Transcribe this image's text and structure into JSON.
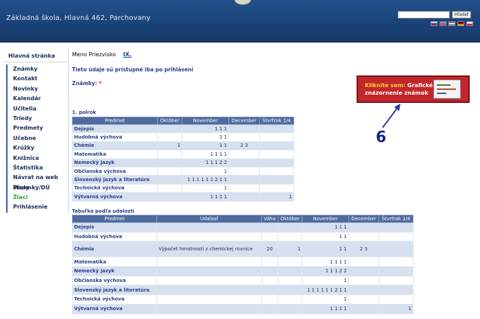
{
  "header": {
    "title": "Základná škola, Hlavná 462, Parchovany",
    "search_button": "Hľadať",
    "flags": [
      "sk",
      "en",
      "hu",
      "de",
      "pl"
    ]
  },
  "sidebar": {
    "title": "Hlavná stránka",
    "items": [
      "Známky",
      "Kontakt",
      "Novinky",
      "Kalendár",
      "Učitelia",
      "Triedy",
      "Predmety",
      "Učebne",
      "Krúžky",
      "Knižnica",
      "Štatistika",
      "Návrat na web školy",
      "Písomky/DÚ",
      "Žiaci",
      "Prihlásenie"
    ],
    "active": "Žiaci"
  },
  "main": {
    "user_name": "Meno Priezvisko",
    "user_class": "IX.",
    "notice": "Tieto údaje sú prístupné iba po prihlásení",
    "grades_label": "Známky:",
    "grades_star": "*"
  },
  "graph_button": {
    "highlight": "Kliknite sem:",
    "text_line1": "Grafické",
    "text_line2": "znázornenie známok"
  },
  "annotation_number": "6",
  "semester": {
    "label": "1. polrok",
    "headers": [
      "Predmet",
      "Október",
      "November",
      "December",
      "Štvrťrok 1/4"
    ],
    "rows": [
      [
        "Dejepis",
        "",
        "1 1 1",
        "",
        ""
      ],
      [
        "Hudobná výchova",
        "",
        "1 1",
        "",
        ""
      ],
      [
        "Chémia",
        "1",
        "1 1",
        "2 3",
        ""
      ],
      [
        "Matematika",
        "",
        "1 1 1 1",
        "",
        ""
      ],
      [
        "Nemecký jazyk",
        "",
        "1 1 1 2 2",
        "",
        ""
      ],
      [
        "Občianska výchova",
        "",
        "1",
        "",
        ""
      ],
      [
        "Slovenský jazyk a literatúra",
        "",
        "1 1 1 1 1 1 2 1 1",
        "",
        ""
      ],
      [
        "Technická výchova",
        "",
        "1",
        "",
        ""
      ],
      [
        "Výtvarná výchova",
        "",
        "1 1 1 1",
        "",
        "1"
      ]
    ]
  },
  "events": {
    "label": "Tabuľka podľa udalostí",
    "headers": [
      "Predmet",
      "Udalosť",
      "Váha",
      "Október",
      "November",
      "December",
      "Štvrťrok 1/4"
    ],
    "rows": [
      [
        "Dejepis",
        "",
        "",
        "",
        "1 1 1",
        "",
        ""
      ],
      [
        "Hudobná výchova",
        "",
        "",
        "",
        "1 1",
        "",
        ""
      ],
      [
        "Chémia",
        "Výpočet hmotnosti z chemickej rovnice",
        "20",
        "1",
        "1 1",
        "2 3",
        ""
      ],
      [
        "Matematika",
        "",
        "",
        "",
        "1 1 1 1",
        "",
        ""
      ],
      [
        "Nemecký jazyk",
        "",
        "",
        "",
        "1 1 1 2 2",
        "",
        ""
      ],
      [
        "Občianska výchova",
        "",
        "",
        "",
        "1",
        "",
        ""
      ],
      [
        "Slovenský jazyk a literatúra",
        "",
        "",
        "",
        "1 1 1 1 1 1 2 1 1",
        "",
        ""
      ],
      [
        "Technická výchova",
        "",
        "",
        "",
        "1",
        "",
        ""
      ],
      [
        "Výtvarná výchova",
        "",
        "",
        "",
        "1 1 1 1",
        "",
        "1"
      ]
    ]
  }
}
